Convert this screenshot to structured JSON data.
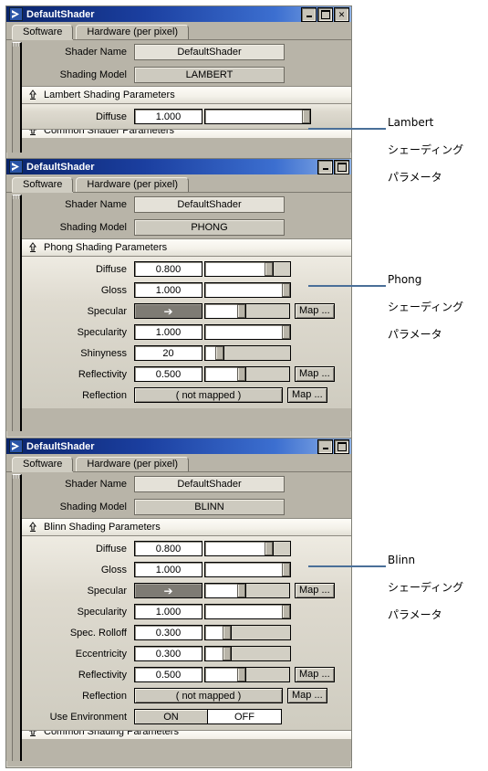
{
  "colors": {
    "title_bar_start": "#0a246a",
    "title_bar_end": "#8fb3e8",
    "window_face": "#b8b4a8",
    "leader_line": "#4a6f98",
    "specular_swatch": "#7e7b74",
    "page_background": "#ffffff"
  },
  "common": {
    "window_title": "DefaultShader",
    "tabs": [
      {
        "label": "Software",
        "active": true
      },
      {
        "label": "Hardware (per pixel)",
        "active": false
      }
    ],
    "shader_name_label": "Shader Name",
    "shader_name_value": "DefaultShader",
    "shading_model_label": "Shading Model",
    "map_button_label": "Map ...",
    "not_mapped_value": "( not mapped )",
    "specular_arrow": "➔",
    "titlebar_icon": "shader-arrow-icon",
    "minimize_label": "Minimize",
    "maximize_label": "Maximize",
    "close_label": "Close",
    "cut_section_label": "Common Shader Parameters"
  },
  "windows": [
    {
      "id": "lambert",
      "title": "DefaultShader",
      "shading_model": "LAMBERT",
      "section_title": "Lambert Shading Parameters",
      "has_close_button": true,
      "rows": [
        {
          "label": "Diffuse",
          "type": "slider",
          "value": "1.000",
          "fill": 100
        }
      ],
      "cut_section": "Common Shader Parameters"
    },
    {
      "id": "phong",
      "title": "DefaultShader",
      "shading_model": "PHONG",
      "section_title": "Phong Shading Parameters",
      "has_close_button": false,
      "rows": [
        {
          "label": "Diffuse",
          "type": "slider",
          "value": "0.800",
          "fill": 80
        },
        {
          "label": "Gloss",
          "type": "slider",
          "value": "1.000",
          "fill": 100
        },
        {
          "label": "Specular",
          "type": "color",
          "value": "",
          "fill": 52,
          "map": "Map ..."
        },
        {
          "label": "Specularity",
          "type": "slider",
          "value": "1.000",
          "fill": 100
        },
        {
          "label": "Shinyness",
          "type": "slider",
          "value": "20",
          "fill": 20
        },
        {
          "label": "Reflectivity",
          "type": "slider",
          "value": "0.500",
          "fill": 50,
          "map": "Map ..."
        },
        {
          "label": "Reflection",
          "type": "mapped",
          "value": "( not mapped )",
          "map": "Map ..."
        }
      ]
    },
    {
      "id": "blinn",
      "title": "DefaultShader",
      "shading_model": "BLINN",
      "section_title": "Blinn Shading Parameters",
      "has_close_button": false,
      "rows": [
        {
          "label": "Diffuse",
          "type": "slider",
          "value": "0.800",
          "fill": 80
        },
        {
          "label": "Gloss",
          "type": "slider",
          "value": "1.000",
          "fill": 100
        },
        {
          "label": "Specular",
          "type": "color",
          "value": "",
          "fill": 52,
          "map": "Map ..."
        },
        {
          "label": "Specularity",
          "type": "slider",
          "value": "1.000",
          "fill": 100
        },
        {
          "label": "Spec. Rolloff",
          "type": "slider",
          "value": "0.300",
          "fill": 30
        },
        {
          "label": "Eccentricity",
          "type": "slider",
          "value": "0.300",
          "fill": 30
        },
        {
          "label": "Reflectivity",
          "type": "slider",
          "value": "0.500",
          "fill": 50,
          "map": "Map ..."
        },
        {
          "label": "Reflection",
          "type": "mapped",
          "value": "( not mapped )",
          "map": "Map ..."
        },
        {
          "label": "Use Environment",
          "type": "toggle",
          "option_on": "ON",
          "option_off": "OFF",
          "selected": "OFF"
        }
      ],
      "cut_section": "Common Shading Parameters"
    }
  ],
  "annotations": [
    {
      "id": "lambert-note",
      "line1": "Lambert",
      "line2": "シェーディング",
      "line3": "パラメータ"
    },
    {
      "id": "phong-note",
      "line1": "Phong",
      "line2": "シェーディング",
      "line3": "パラメータ"
    },
    {
      "id": "blinn-note",
      "line1": "Blinn",
      "line2": "シェーディング",
      "line3": "パラメータ"
    }
  ]
}
